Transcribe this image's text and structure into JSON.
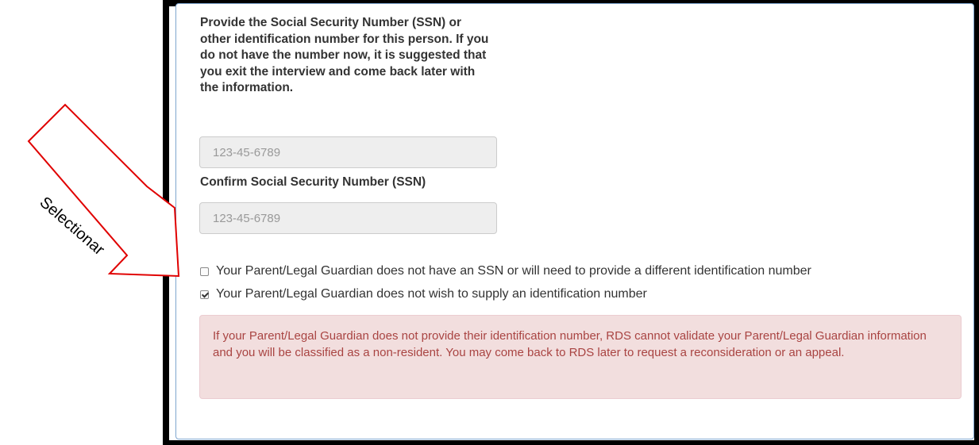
{
  "form": {
    "ssn_question": "Provide the Social Security Number (SSN) or other identification number for this person. If you do not have the number now, it is suggested that you exit the interview and come back later with the information.",
    "ssn_placeholder": "123-45-6789",
    "confirm_label": "Confirm Social Security Number (SSN)",
    "confirm_placeholder": "123-45-6789",
    "options": [
      {
        "label": "Your Parent/Legal Guardian does not have an SSN or will need to provide a different identification number",
        "checked": false
      },
      {
        "label": "Your Parent/Legal Guardian does not wish to supply an identification number",
        "checked": true
      }
    ],
    "alert_text": "If your Parent/Legal Guardian does not provide their identification number, RDS cannot validate your Parent/Legal Guardian information and you will be classified as a non-resident. You may come back to RDS later to request a reconsideration or an appeal."
  },
  "annotation": {
    "label": "Selectionar",
    "color": "#e00000"
  },
  "colors": {
    "alert_bg": "#f2dede",
    "alert_text": "#a94442",
    "panel_border": "#7fa6cf",
    "input_bg": "#eeeeee"
  }
}
